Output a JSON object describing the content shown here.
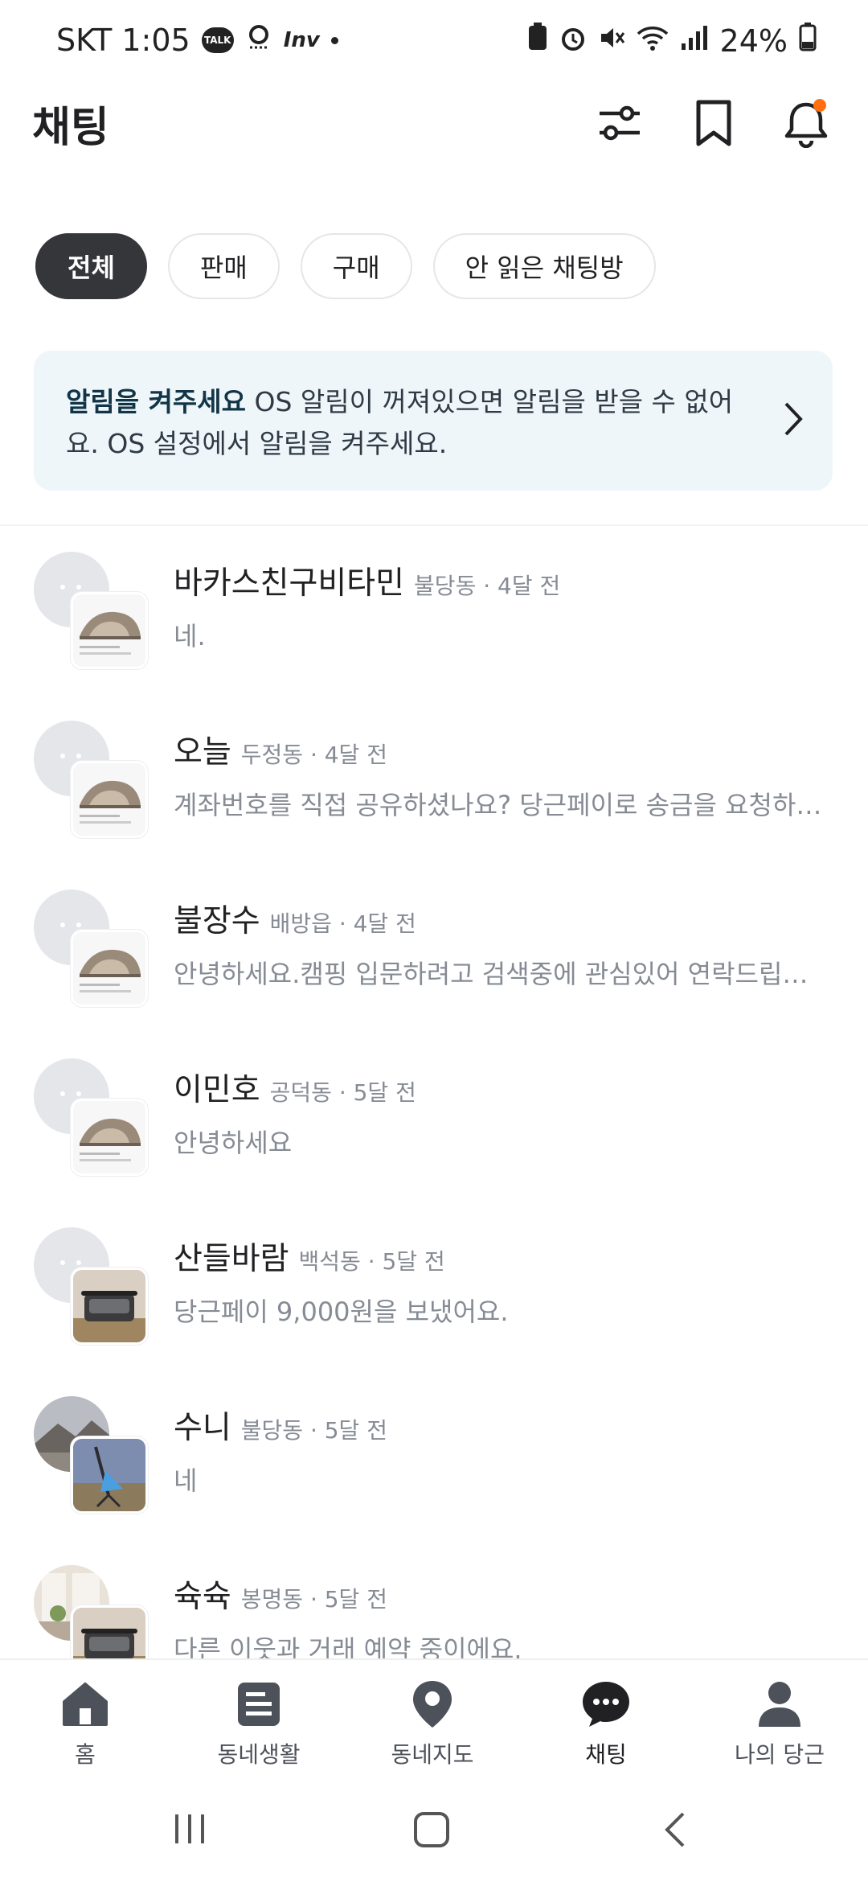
{
  "status_bar": {
    "carrier_time": "SKT 1:05",
    "talk_badge": "TALK",
    "inv_label": "Inv",
    "battery": "24%"
  },
  "header": {
    "title": "채팅",
    "icons": [
      "filter-sliders-icon",
      "bookmark-icon",
      "bell-icon"
    ]
  },
  "filters": [
    "전체",
    "판매",
    "구매",
    "안 읽은 채팅방"
  ],
  "banner": {
    "bold": "알림을 켜주세요",
    "text": " OS 알림이 꺼져있으면 알림을 받을 수 없어요. OS 설정에서 알림을 켜주세요."
  },
  "chats": [
    {
      "name": "바카스친구비타민",
      "meta": "불당동 · 4달 전",
      "message": "네."
    },
    {
      "name": "오늘",
      "meta": "두정동 · 4달 전",
      "message": "계좌번호를 직접 공유하셨나요? 당근페이로 송금을 요청하세요."
    },
    {
      "name": "불장수",
      "meta": "배방읍 · 4달 전",
      "message": "안녕하세요.캠핑 입문하려고 검색중에 관심있어 연락드립니다."
    },
    {
      "name": "이민호",
      "meta": "공덕동 · 5달 전",
      "message": "안녕하세요"
    },
    {
      "name": "산들바람",
      "meta": "백석동 · 5달 전",
      "message": "당근페이 9,000원을 보냈어요."
    },
    {
      "name": "수니",
      "meta": "불당동 · 5달 전",
      "message": "네"
    },
    {
      "name": "슉슉",
      "meta": "봉명동 · 5달 전",
      "message": "다른 이웃과 거래 예약 중이에요."
    }
  ],
  "bottom_nav": [
    {
      "label": "홈",
      "icon": "home-icon"
    },
    {
      "label": "동네생활",
      "icon": "board-icon"
    },
    {
      "label": "동네지도",
      "icon": "map-pin-icon"
    },
    {
      "label": "채팅",
      "icon": "chat-icon"
    },
    {
      "label": "나의 당근",
      "icon": "person-icon"
    }
  ],
  "colors": {
    "accent": "#ff6f0f",
    "chip_active": "#35363a",
    "banner_bg": "#eef6fa"
  }
}
